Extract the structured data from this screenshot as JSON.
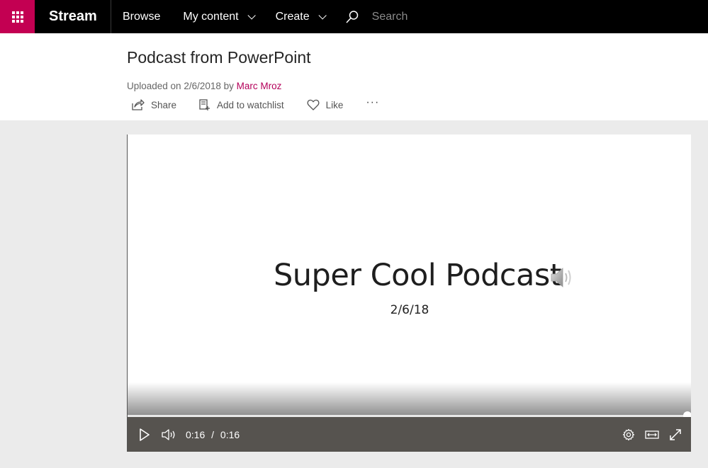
{
  "topbar": {
    "brand": "Stream",
    "nav": [
      {
        "label": "Browse",
        "has_dropdown": false
      },
      {
        "label": "My content",
        "has_dropdown": true
      },
      {
        "label": "Create",
        "has_dropdown": true
      }
    ],
    "search": {
      "placeholder": "Search"
    }
  },
  "video": {
    "title": "Podcast from PowerPoint",
    "uploaded_prefix": "Uploaded on 2/6/2018 by ",
    "author": "Marc Mroz",
    "actions": {
      "share": "Share",
      "watchlist": "Add to watchlist",
      "like": "Like",
      "more": "···"
    }
  },
  "slide": {
    "title": "Super Cool Podcast",
    "date": "2/6/18"
  },
  "player": {
    "current_time": "0:16",
    "separator": "/",
    "duration": "0:16",
    "progress_fraction": 1.0
  },
  "colors": {
    "accent": "#c30052",
    "author_link": "#b4005a",
    "controls_bg": "#56534f"
  }
}
